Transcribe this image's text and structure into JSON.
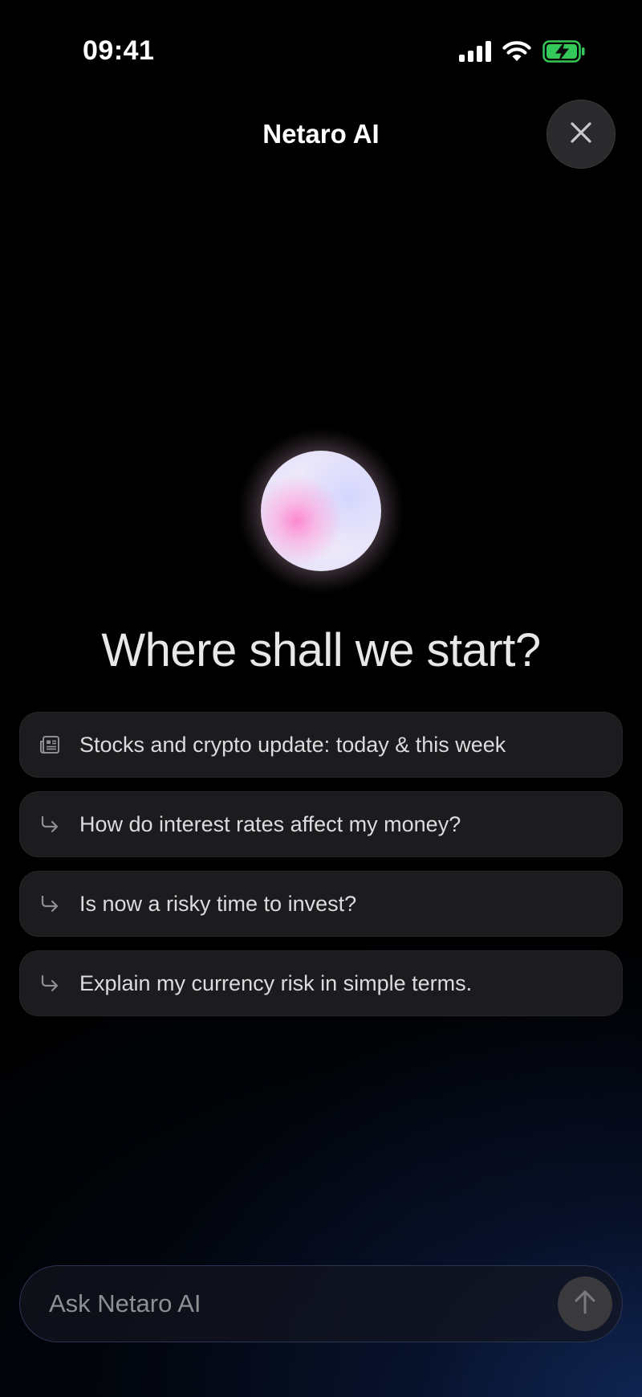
{
  "status_bar": {
    "time": "09:41",
    "icons": [
      "signal-icon",
      "wifi-icon",
      "battery-charging-icon"
    ],
    "battery_color": "#34c759"
  },
  "header": {
    "title": "Netaro AI",
    "close_icon": "close-icon"
  },
  "hero": {
    "orb_icon": "ai-orb",
    "headline": "Where shall we start?"
  },
  "suggestions": [
    {
      "icon": "news-icon",
      "label": "Stocks and crypto update: today & this week"
    },
    {
      "icon": "reply-arrow-icon",
      "label": "How do interest rates affect my money?"
    },
    {
      "icon": "reply-arrow-icon",
      "label": "Is now a risky time to invest?"
    },
    {
      "icon": "reply-arrow-icon",
      "label": "Explain my currency risk in simple terms."
    }
  ],
  "composer": {
    "placeholder": "Ask Netaro AI",
    "value": "",
    "send_icon": "arrow-up-icon"
  }
}
